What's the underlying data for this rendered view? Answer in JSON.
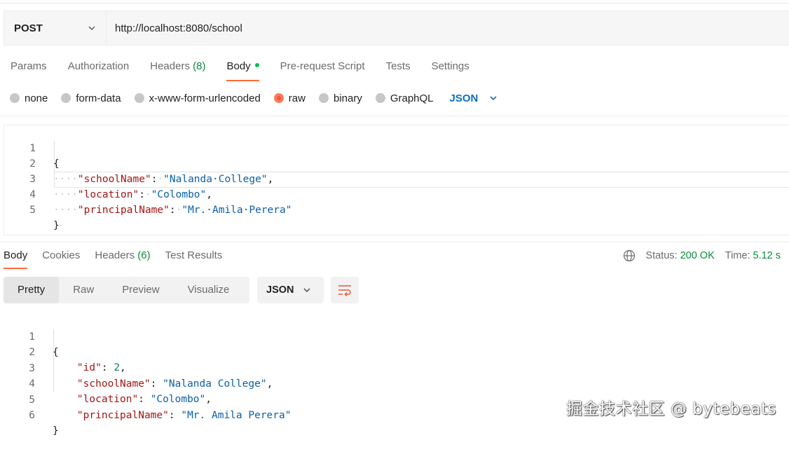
{
  "request": {
    "method": "POST",
    "url": "http://localhost:8080/school",
    "tabs": [
      {
        "label": "Params"
      },
      {
        "label": "Authorization"
      },
      {
        "label": "Headers",
        "count": "(8)"
      },
      {
        "label": "Body"
      },
      {
        "label": "Pre-request Script"
      },
      {
        "label": "Tests"
      },
      {
        "label": "Settings"
      }
    ],
    "body_types": [
      "none",
      "form-data",
      "x-www-form-urlencoded",
      "raw",
      "binary",
      "GraphQL"
    ],
    "selected_body_type": "raw",
    "format": "JSON",
    "lines": [
      "1",
      "2",
      "3",
      "4",
      "5"
    ],
    "body": {
      "open": "{",
      "close": "}",
      "fields": [
        {
          "key": "\"schoolName\"",
          "value": "\"Nalanda College\"",
          "dots_value": "\"Nalanda·College\""
        },
        {
          "key": "\"location\"",
          "value": "\"Colombo\""
        },
        {
          "key": "\"principalName\"",
          "value": "\"Mr. Amila Perera\"",
          "dots_value": "\"Mr.·Amila·Perera\""
        }
      ]
    }
  },
  "response": {
    "tabs": [
      {
        "label": "Body"
      },
      {
        "label": "Cookies"
      },
      {
        "label": "Headers",
        "count": "(6)"
      },
      {
        "label": "Test Results"
      }
    ],
    "status_label": "Status:",
    "status_value": "200 OK",
    "time_label": "Time:",
    "time_value": "5.12 s",
    "view_modes": [
      "Pretty",
      "Raw",
      "Preview",
      "Visualize"
    ],
    "format": "JSON",
    "lines": [
      "1",
      "2",
      "3",
      "4",
      "5",
      "6"
    ],
    "body": {
      "open": "{",
      "close": "}",
      "id_key": "\"id\"",
      "id_value": "2",
      "schoolName_key": "\"schoolName\"",
      "schoolName_value": "\"Nalanda College\"",
      "location_key": "\"location\"",
      "location_value": "\"Colombo\"",
      "principalName_key": "\"principalName\"",
      "principalName_value": "\"Mr. Amila Perera\""
    }
  },
  "watermark": "掘金技术社区 @ bytebeats",
  "colors": {
    "accent": "#ff6c37",
    "json_blue": "#0d6ec2",
    "status_green": "#0a8a3c"
  }
}
